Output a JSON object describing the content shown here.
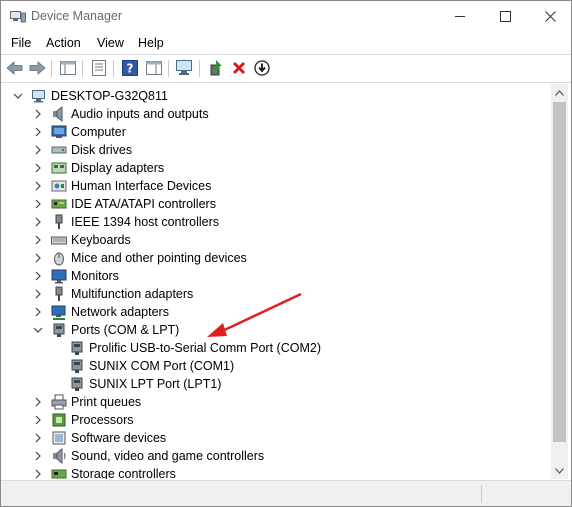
{
  "window": {
    "title": "Device Manager",
    "icon": "device-manager-icon",
    "controls": [
      "minimize-icon",
      "maximize-icon",
      "close-icon"
    ]
  },
  "menu": {
    "file": "File",
    "action": "Action",
    "view": "View",
    "help": "Help"
  },
  "toolbar": {
    "icons": [
      "back-arrow-icon",
      "forward-arrow-icon",
      "show-hide-console-tree-icon",
      "properties-icon",
      "help-icon",
      "action-pane-icon",
      "scan-for-hardware-changes-icon",
      "update-driver-icon",
      "uninstall-device-icon",
      "disable-device-icon"
    ]
  },
  "tree": {
    "root": "DESKTOP-G32Q811",
    "items": [
      {
        "label": "Audio inputs and outputs",
        "icon": "speaker-icon",
        "expanded": false
      },
      {
        "label": "Computer",
        "icon": "computer-icon",
        "expanded": false
      },
      {
        "label": "Disk drives",
        "icon": "disk-drive-icon",
        "expanded": false
      },
      {
        "label": "Display adapters",
        "icon": "display-adapter-icon",
        "expanded": false
      },
      {
        "label": "Human Interface Devices",
        "icon": "hid-icon",
        "expanded": false
      },
      {
        "label": "IDE ATA/ATAPI controllers",
        "icon": "ide-controller-icon",
        "expanded": false
      },
      {
        "label": "IEEE 1394 host controllers",
        "icon": "ieee1394-icon",
        "expanded": false
      },
      {
        "label": "Keyboards",
        "icon": "keyboard-icon",
        "expanded": false
      },
      {
        "label": "Mice and other pointing devices",
        "icon": "mouse-icon",
        "expanded": false
      },
      {
        "label": "Monitors",
        "icon": "monitor-icon",
        "expanded": false
      },
      {
        "label": "Multifunction adapters",
        "icon": "multifunction-icon",
        "expanded": false
      },
      {
        "label": "Network adapters",
        "icon": "network-icon",
        "expanded": false
      },
      {
        "label": "Ports (COM & LPT)",
        "icon": "port-icon",
        "expanded": true,
        "children": [
          "Prolific USB-to-Serial Comm Port (COM2)",
          "SUNIX COM Port (COM1)",
          "SUNIX LPT Port (LPT1)"
        ]
      },
      {
        "label": "Print queues",
        "icon": "printer-icon",
        "expanded": false
      },
      {
        "label": "Processors",
        "icon": "processor-icon",
        "expanded": false
      },
      {
        "label": "Software devices",
        "icon": "software-device-icon",
        "expanded": false
      },
      {
        "label": "Sound, video and game controllers",
        "icon": "sound-icon",
        "expanded": false
      },
      {
        "label": "Storage controllers",
        "icon": "storage-icon",
        "expanded": false
      }
    ]
  },
  "annotation": {
    "arrow_color": "#e02020"
  }
}
